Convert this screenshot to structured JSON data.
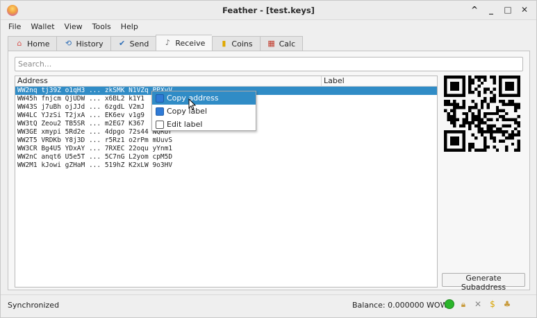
{
  "window": {
    "title": "Feather - [test.keys]"
  },
  "window_controls": {
    "maximize": "^",
    "minimize": "_",
    "restore": "□",
    "close": "✕"
  },
  "menu": [
    "File",
    "Wallet",
    "View",
    "Tools",
    "Help"
  ],
  "tabs": [
    {
      "label": "Home",
      "icon": "home-icon",
      "active": false
    },
    {
      "label": "History",
      "icon": "history-icon",
      "active": false
    },
    {
      "label": "Send",
      "icon": "send-icon",
      "active": false
    },
    {
      "label": "Receive",
      "icon": "receive-icon",
      "active": true
    },
    {
      "label": "Coins",
      "icon": "coins-icon",
      "active": false
    },
    {
      "label": "Calc",
      "icon": "calculator-icon",
      "active": false
    }
  ],
  "search": {
    "placeholder": "Search...",
    "value": ""
  },
  "table": {
    "columns": [
      "Address",
      "Label"
    ],
    "rows": [
      "WW2nq tj39Z o1qH3 ... zkSMK N1VZq PPXvV",
      "WW45h fnjcm QjUDW ... x6BL2 k1Y1",
      "WW43S j7uBh ojJJd ... 6zgdL V2mJ",
      "WW4LC YJzSi T2jxA ... EK6ev v1g9",
      "WW3tQ Zeou2 TB5SR ... m2EG7 K367",
      "WW3GE xmypi 5Rd2e ... 4dpgo 72s44 NQRUr",
      "WW2T5 VRDKb Y8j3D ... r5Rz1 o2rPm mUuvS",
      "WW3CR Bg4U5 YDxAY ... 7RXEC 22oqu yYnm1",
      "WW2nC anqt6 U5e5T ... 5C7nG L2yom cpM5D",
      "WW2M1 kJowi gZHaM ... 519hZ K2xLW 9o3HV"
    ],
    "selected_index": 0
  },
  "context_menu": [
    {
      "label": "Copy address",
      "icon": "copy-icon",
      "hover": true
    },
    {
      "label": "Copy label",
      "icon": "copy-icon",
      "hover": false
    },
    {
      "label": "Edit label",
      "icon": "edit-icon",
      "hover": false
    }
  ],
  "generate_button": "Generate Subaddress",
  "status": {
    "text": "Synchronized",
    "balance": "Balance: 0.000000 WOW",
    "connection_color": "#2bb52b"
  },
  "colors": {
    "selection": "#308cc6"
  }
}
